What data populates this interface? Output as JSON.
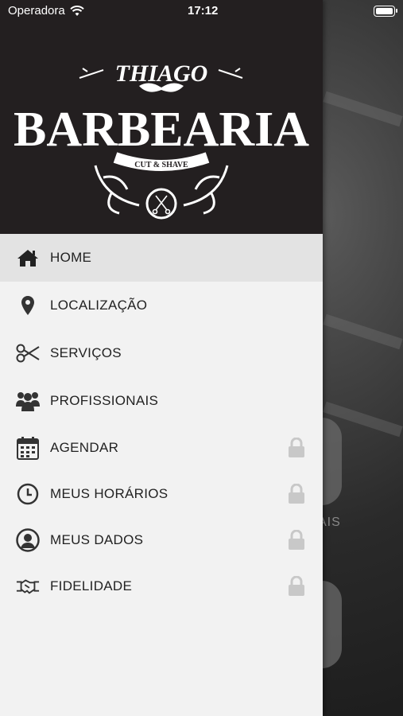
{
  "status_bar": {
    "carrier": "Operadora",
    "time": "17:12",
    "battery_level": 1.0
  },
  "brand": {
    "top": "THIAGO",
    "main": "BARBEARIA",
    "ribbon": "CUT & SHAVE"
  },
  "menu": [
    {
      "label": "HOME",
      "icon": "home-icon",
      "locked": false,
      "active": true
    },
    {
      "label": "LOCALIZAÇÃO",
      "icon": "location-pin-icon",
      "locked": false,
      "active": false
    },
    {
      "label": "SERVIÇOS",
      "icon": "scissors-icon",
      "locked": false,
      "active": false
    },
    {
      "label": "PROFISSIONAIS",
      "icon": "people-icon",
      "locked": false,
      "active": false
    },
    {
      "label": "AGENDAR",
      "icon": "calendar-icon",
      "locked": true,
      "active": false
    },
    {
      "label": "MEUS HORÁRIOS",
      "icon": "clock-icon",
      "locked": true,
      "active": false
    },
    {
      "label": "MEUS DADOS",
      "icon": "user-icon",
      "locked": true,
      "active": false
    },
    {
      "label": "FIDELIDADE",
      "icon": "handshake-icon",
      "locked": true,
      "active": false
    }
  ],
  "background": {
    "partial_text": "AIS"
  },
  "colors": {
    "header": "#231f20",
    "drawer": "#f2f2f2",
    "active_row": "#e3e3e3",
    "icon": "#333333",
    "lock": "#c8c8c8"
  }
}
